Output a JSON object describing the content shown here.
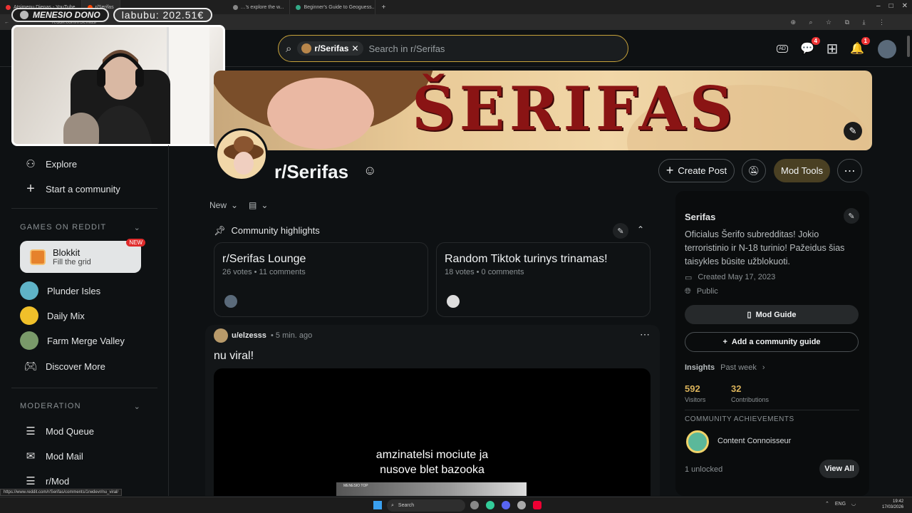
{
  "browser": {
    "tabs": [
      {
        "label": "Atsimenu Dienas - YouTube"
      },
      {
        "label": "r/Serifas"
      },
      {
        "label": "…'s explore the w..."
      },
      {
        "label": "Beginner's Guide to Geoguess..."
      }
    ],
    "url": "reddit.com/r/Serifas/"
  },
  "stream_overlay": {
    "dono_label": "MENESIO DONO",
    "dono_value": "labubu: 202.51€"
  },
  "header": {
    "search_chip": "r/Serifas",
    "search_placeholder": "Search in r/Serifas",
    "chat_badge": "4",
    "notif_badge": "1"
  },
  "sidebar": {
    "explore": "Explore",
    "start_community": "Start a community",
    "games_heading": "GAMES ON REDDIT",
    "blokkit_title": "Blokkit",
    "blokkit_sub": "Fill the grid",
    "blokkit_badge": "NEW",
    "games": [
      "Plunder Isles",
      "Daily Mix",
      "Farm Merge Valley",
      "Discover More"
    ],
    "moderation_heading": "MODERATION",
    "mod_items": [
      "Mod Queue",
      "Mod Mail",
      "r/Mod"
    ]
  },
  "banner": {
    "title": "ŠERIFAS"
  },
  "community": {
    "name": "r/Serifas",
    "create_post": "Create Post",
    "mod_tools": "Mod Tools",
    "sort": "New"
  },
  "highlights": {
    "heading": "Community highlights",
    "cards": [
      {
        "title": "r/Serifas Lounge",
        "meta": "26 votes • 11 comments"
      },
      {
        "title": "Random Tiktok turinys trinamas!",
        "meta": "18 votes • 0 comments"
      }
    ]
  },
  "post": {
    "author": "u/elzesss",
    "time": "• 5 min. ago",
    "title": "nu viral!",
    "video_caption_1": "amzinatelsi mociute ja",
    "video_caption_2": "nusove blet bazooka",
    "video_inset": "MENESIO TOP"
  },
  "right_panel": {
    "name": "Serifas",
    "description": "Oficialus Šerifo subredditas! Jokio terroristinio ir N-18 turinio! Pažeidus šias taisykles būsite užblokuoti.",
    "created": "Created May 17, 2023",
    "visibility": "Public",
    "mod_guide": "Mod Guide",
    "add_guide": "Add a community guide",
    "insights": "Insights",
    "past_week": "Past week",
    "visitors_value": "592",
    "visitors_label": "Visitors",
    "contrib_value": "32",
    "contrib_label": "Contributions",
    "achievements_heading": "COMMUNITY ACHIEVEMENTS",
    "achievement": "Content Connoisseur",
    "unlocked": "1 unlocked",
    "view_all": "View All"
  },
  "status_url": "https://www.reddit.com/r/Serifas/comments/1rwdevr/nu_viral/",
  "taskbar": {
    "search": "Search",
    "lang": "ENG",
    "time": "19:42",
    "date": "17/03/2026"
  },
  "colors": {
    "accent_gold": "#c7a23a",
    "mod_tools_bg": "#4a4023",
    "banner_red": "#8a1414"
  }
}
